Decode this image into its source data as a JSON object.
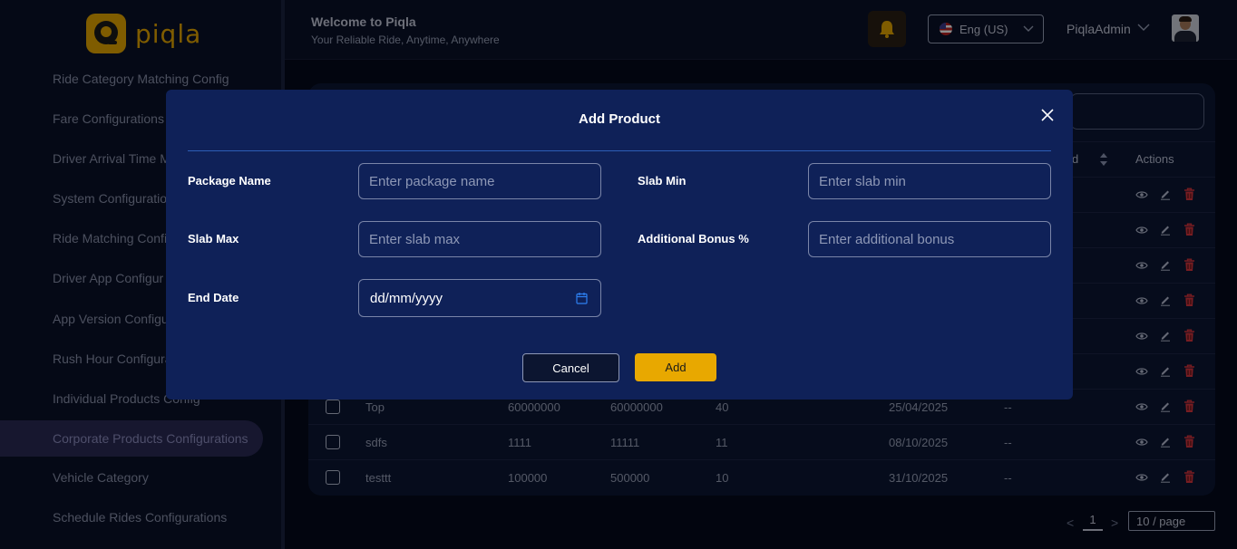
{
  "brand": {
    "name": "piqla"
  },
  "header": {
    "title": "Welcome to Piqla",
    "subtitle": "Your Reliable Ride, Anytime, Anywhere",
    "language": "Eng (US)",
    "user": "PiqlaAdmin"
  },
  "sidebar": {
    "active": "Corporate Products Configurations",
    "items": [
      "Ride Category Matching Config",
      "Fare Configurations",
      "Driver Arrival Time M",
      "System Configuratio",
      "Ride Matching Confi",
      "Driver App Configur",
      "App Version Configu",
      "Rush Hour Configura",
      "Individual Products Config",
      "Corporate Products Configurations",
      "Vehicle Category",
      "Schedule Rides Configurations"
    ]
  },
  "table": {
    "header_end": "d",
    "header_actions": "Actions",
    "rows": [
      {
        "name": "Top",
        "slab_min": "60000000",
        "slab_max": "60000000",
        "bonus": "40",
        "end_date": "25/04/2025",
        "extra": "--"
      },
      {
        "name": "sdfs",
        "slab_min": "1111",
        "slab_max": "11111",
        "bonus": "11",
        "end_date": "08/10/2025",
        "extra": "--"
      },
      {
        "name": "testtt",
        "slab_min": "100000",
        "slab_max": "500000",
        "bonus": "10",
        "end_date": "31/10/2025",
        "extra": "--"
      }
    ]
  },
  "pagination": {
    "prev": "<",
    "current": "1",
    "next": ">",
    "page_size": "10 / page"
  },
  "modal": {
    "title": "Add Product",
    "fields": {
      "package_name": {
        "label": "Package Name",
        "placeholder": "Enter package name"
      },
      "slab_min": {
        "label": "Slab Min",
        "placeholder": "Enter slab min"
      },
      "slab_max": {
        "label": "Slab Max",
        "placeholder": "Enter slab max"
      },
      "additional_bonus": {
        "label": "Additional Bonus %",
        "placeholder": "Enter additional bonus"
      },
      "end_date": {
        "label": "End Date",
        "value": "dd/mm/yyyy"
      }
    },
    "cancel_label": "Cancel",
    "add_label": "Add"
  },
  "colors": {
    "accent": "#e8a800",
    "background": "#050a1c",
    "modal": "#0f2158",
    "danger": "#d9363e"
  }
}
